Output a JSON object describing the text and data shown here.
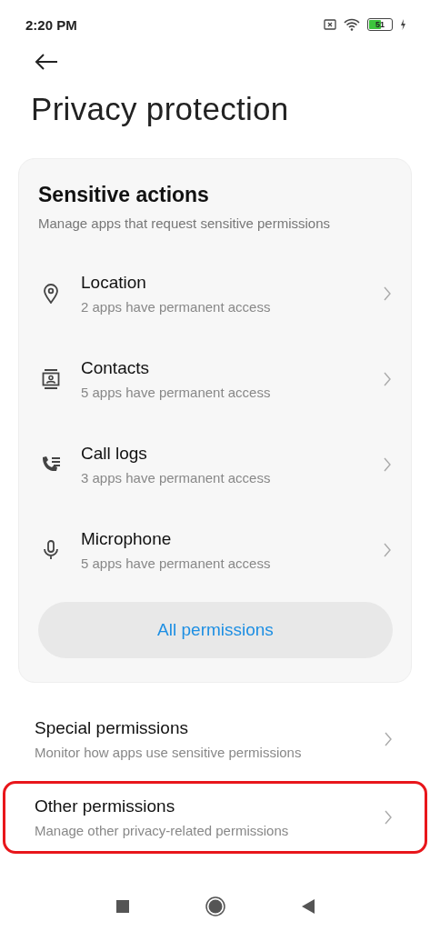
{
  "status_bar": {
    "time": "2:20 PM",
    "battery": "51"
  },
  "title": "Privacy protection",
  "card": {
    "title": "Sensitive actions",
    "subtitle": "Manage apps that request sensitive permissions",
    "items": [
      {
        "label": "Location",
        "detail": "2 apps have permanent access"
      },
      {
        "label": "Contacts",
        "detail": "5 apps have permanent access"
      },
      {
        "label": "Call logs",
        "detail": "3 apps have permanent access"
      },
      {
        "label": "Microphone",
        "detail": "5 apps have permanent access"
      }
    ],
    "button": "All permissions"
  },
  "items": [
    {
      "label": "Special permissions",
      "detail": "Monitor how apps use sensitive permissions",
      "highlighted": false
    },
    {
      "label": "Other permissions",
      "detail": "Manage other privacy-related permissions",
      "highlighted": true
    }
  ]
}
